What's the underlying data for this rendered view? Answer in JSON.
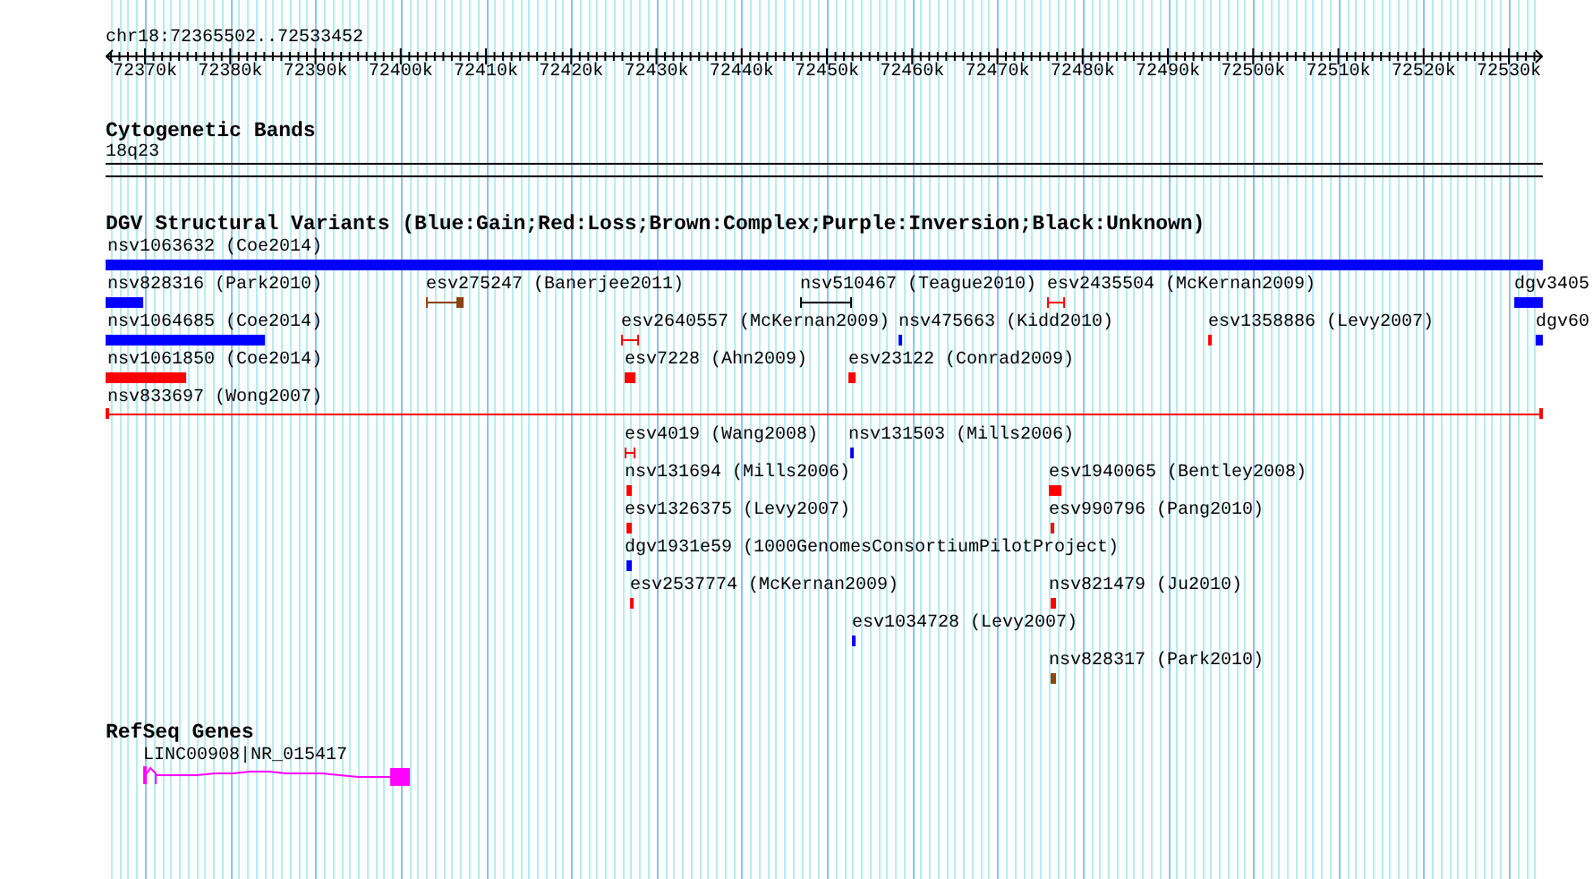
{
  "ruler": {
    "range": "chr18:72365502..72533452",
    "ticks": [
      "72370k",
      "72380k",
      "72390k",
      "72400k",
      "72410k",
      "72420k",
      "72430k",
      "72440k",
      "72450k",
      "72460k",
      "72470k",
      "72480k",
      "72490k",
      "72500k",
      "72510k",
      "72520k",
      "72530k"
    ]
  },
  "tracks": [
    {
      "kind": "bands",
      "title": "Cytogenetic Bands",
      "label": "18q23"
    },
    {
      "kind": "variants",
      "title": "DGV Structural Variants (Blue:Gain;Red:Loss;Brown:Complex;Purple:Inversion;Black:Unknown)",
      "rows": [
        [
          {
            "label": "nsv1063632 (Coe2014)",
            "color": "#0000ff",
            "kind": "bar"
          }
        ],
        [
          {
            "label": "nsv828316 (Park2010)",
            "color": "#0000ff",
            "kind": "bar"
          },
          {
            "label": "esv275247 (Banerjee2011)",
            "color": "#8b4513",
            "kind": "span-box"
          },
          {
            "label": "nsv510467 (Teague2010)",
            "color": "#000000",
            "kind": "span"
          },
          {
            "label": "esv2435504 (McKernan2009)",
            "color": "#ff0000",
            "kind": "span"
          },
          {
            "label": "dgv3405",
            "color": "#0000ff",
            "kind": "bar"
          }
        ],
        [
          {
            "label": "nsv1064685 (Coe2014)",
            "color": "#0000ff",
            "kind": "bar"
          },
          {
            "label": "esv2640557 (McKernan2009)",
            "color": "#ff0000",
            "kind": "span"
          },
          {
            "label": "nsv475663 (Kidd2010)",
            "color": "#0000ff",
            "kind": "bar"
          },
          {
            "label": "esv1358886 (Levy2007)",
            "color": "#ff0000",
            "kind": "bar"
          },
          {
            "label": "dgv60",
            "color": "#0000ff",
            "kind": "bar"
          }
        ],
        [
          {
            "label": "nsv1061850 (Coe2014)",
            "color": "#ff0000",
            "kind": "bar"
          },
          {
            "label": "esv7228 (Ahn2009)",
            "color": "#ff0000",
            "kind": "bar"
          },
          {
            "label": "esv23122 (Conrad2009)",
            "color": "#ff0000",
            "kind": "bar"
          }
        ],
        [
          {
            "label": "nsv833697 (Wong2007)",
            "color": "#ff0000",
            "kind": "line"
          }
        ],
        [
          {
            "label": "esv4019 (Wang2008)",
            "color": "#ff0000",
            "kind": "span"
          },
          {
            "label": "nsv131503 (Mills2006)",
            "color": "#0000ff",
            "kind": "bar"
          }
        ],
        [
          {
            "label": "nsv131694 (Mills2006)",
            "color": "#ff0000",
            "kind": "bar"
          },
          {
            "label": "esv1940065 (Bentley2008)",
            "color": "#ff0000",
            "kind": "bar"
          }
        ],
        [
          {
            "label": "esv1326375 (Levy2007)",
            "color": "#ff0000",
            "kind": "bar"
          },
          {
            "label": "esv990796 (Pang2010)",
            "color": "#ff0000",
            "kind": "bar"
          }
        ],
        [
          {
            "label": "dgv1931e59 (1000GenomesConsortiumPilotProject)",
            "color": "#0000ff",
            "kind": "bar"
          }
        ],
        [
          {
            "label": "esv2537774 (McKernan2009)",
            "color": "#ff0000",
            "kind": "bar"
          },
          {
            "label": "nsv821479 (Ju2010)",
            "color": "#ff0000",
            "kind": "bar"
          }
        ],
        [
          {
            "label": "esv1034728 (Levy2007)",
            "color": "#0000ff",
            "kind": "bar"
          }
        ],
        [
          {
            "label": "nsv828317 (Park2010)",
            "color": "#8b4513",
            "kind": "bar"
          }
        ]
      ]
    },
    {
      "kind": "genes",
      "title": "RefSeq Genes",
      "label": "LINC00908|NR_015417",
      "color": "#ff00ff"
    }
  ]
}
